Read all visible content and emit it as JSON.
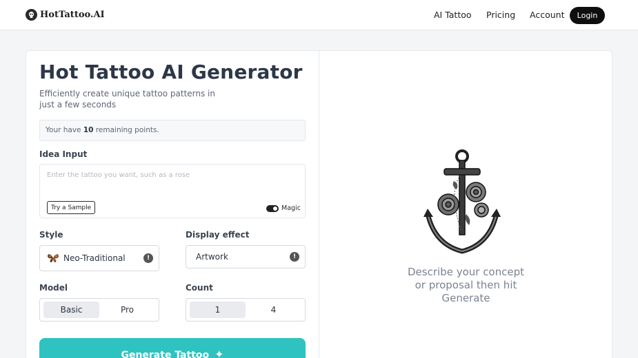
{
  "header": {
    "logo_text": "HotTattoo.AI",
    "nav": [
      "AI Tattoo",
      "Pricing",
      "Account"
    ],
    "login_label": "Login"
  },
  "main": {
    "title": "Hot Tattoo AI Generator",
    "subtitle": "Efficiently create unique tattoo patterns in just a few seconds",
    "points": {
      "prefix": "Your have",
      "count": "10",
      "suffix": "remaining points."
    },
    "idea": {
      "label": "Idea Input",
      "placeholder": "Enter the tattoo you want, such as a rose",
      "sample_button": "Try a Sample",
      "magic_label": "Magic",
      "magic_on": true
    },
    "style": {
      "label": "Style",
      "value": "Neo-Traditional",
      "icon": "butterfly-icon"
    },
    "display": {
      "label": "Display effect",
      "value": "Artwork"
    },
    "model": {
      "label": "Model",
      "options": [
        "Basic",
        "Pro"
      ],
      "selected": "Basic"
    },
    "count": {
      "label": "Count",
      "options": [
        "1",
        "4"
      ],
      "selected": "1"
    },
    "generate_label": "Generate Tattoo"
  },
  "preview": {
    "image": "anchor-with-roses-tattoo",
    "description": "Describe your concept or proposal then hit Generate"
  },
  "colors": {
    "accent": "#2ec3c1",
    "dark": "#0f0f0f",
    "background": "#f3f5f7"
  }
}
